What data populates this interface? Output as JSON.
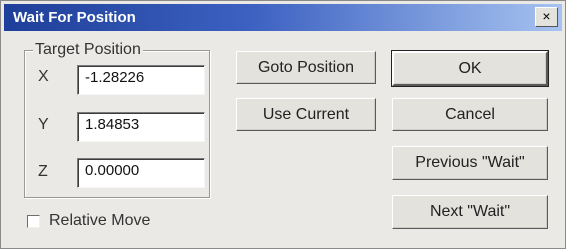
{
  "window": {
    "title": "Wait For Position",
    "close_label": "×"
  },
  "target_position": {
    "legend": "Target Position",
    "fields": [
      {
        "axis": "X",
        "value": "-1.28226"
      },
      {
        "axis": "Y",
        "value": "1.84853"
      },
      {
        "axis": "Z",
        "value": "0.00000"
      }
    ]
  },
  "buttons": {
    "goto_position": "Goto Position",
    "use_current": "Use Current",
    "ok": "OK",
    "cancel": "Cancel",
    "previous_wait": "Previous \"Wait\"",
    "next_wait": "Next \"Wait\""
  },
  "relative_move": {
    "label": "Relative Move",
    "checked": false
  }
}
